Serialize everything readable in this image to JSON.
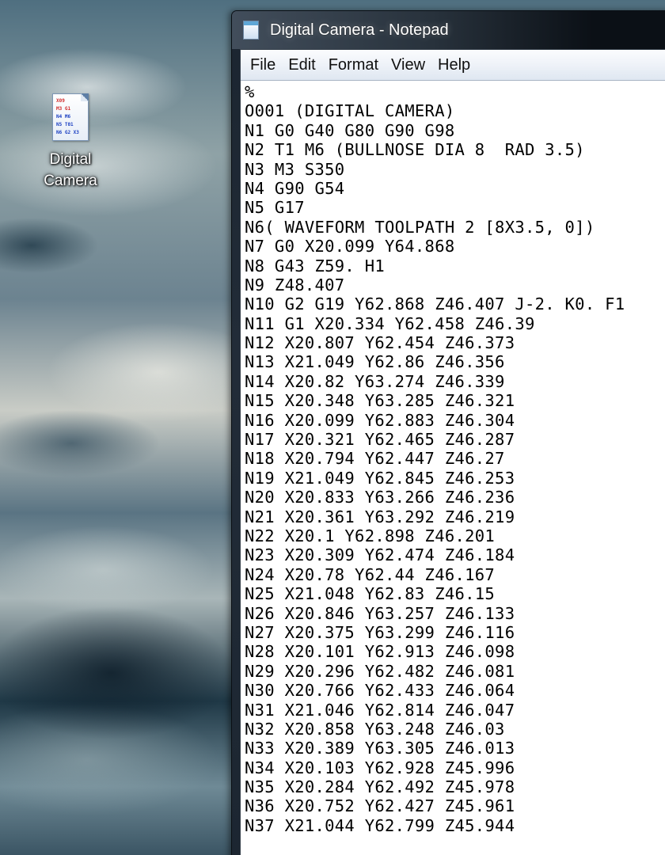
{
  "desktop": {
    "icon_label": "Digital Camera",
    "file_glyph_lines": [
      "X09",
      "M3 G1",
      "N4 M6",
      "N5 T01",
      "N6 G2 X3"
    ]
  },
  "window": {
    "title": "Digital Camera - Notepad",
    "menu": [
      "File",
      "Edit",
      "Format",
      "View",
      "Help"
    ]
  },
  "editor": {
    "lines": [
      "%",
      "O001 (DIGITAL CAMERA)",
      "N1 G0 G40 G80 G90 G98",
      "N2 T1 M6 (BULLNOSE DIA 8  RAD 3.5)",
      "N3 M3 S350",
      "N4 G90 G54",
      "N5 G17",
      "N6( WAVEFORM TOOLPATH 2 [8X3.5, 0])",
      "N7 G0 X20.099 Y64.868",
      "N8 G43 Z59. H1",
      "N9 Z48.407",
      "N10 G2 G19 Y62.868 Z46.407 J-2. K0. F1",
      "N11 G1 X20.334 Y62.458 Z46.39",
      "N12 X20.807 Y62.454 Z46.373",
      "N13 X21.049 Y62.86 Z46.356",
      "N14 X20.82 Y63.274 Z46.339",
      "N15 X20.348 Y63.285 Z46.321",
      "N16 X20.099 Y62.883 Z46.304",
      "N17 X20.321 Y62.465 Z46.287",
      "N18 X20.794 Y62.447 Z46.27",
      "N19 X21.049 Y62.845 Z46.253",
      "N20 X20.833 Y63.266 Z46.236",
      "N21 X20.361 Y63.292 Z46.219",
      "N22 X20.1 Y62.898 Z46.201",
      "N23 X20.309 Y62.474 Z46.184",
      "N24 X20.78 Y62.44 Z46.167",
      "N25 X21.048 Y62.83 Z46.15",
      "N26 X20.846 Y63.257 Z46.133",
      "N27 X20.375 Y63.299 Z46.116",
      "N28 X20.101 Y62.913 Z46.098",
      "N29 X20.296 Y62.482 Z46.081",
      "N30 X20.766 Y62.433 Z46.064",
      "N31 X21.046 Y62.814 Z46.047",
      "N32 X20.858 Y63.248 Z46.03",
      "N33 X20.389 Y63.305 Z46.013",
      "N34 X20.103 Y62.928 Z45.996",
      "N35 X20.284 Y62.492 Z45.978",
      "N36 X20.752 Y62.427 Z45.961",
      "N37 X21.044 Y62.799 Z45.944"
    ]
  }
}
